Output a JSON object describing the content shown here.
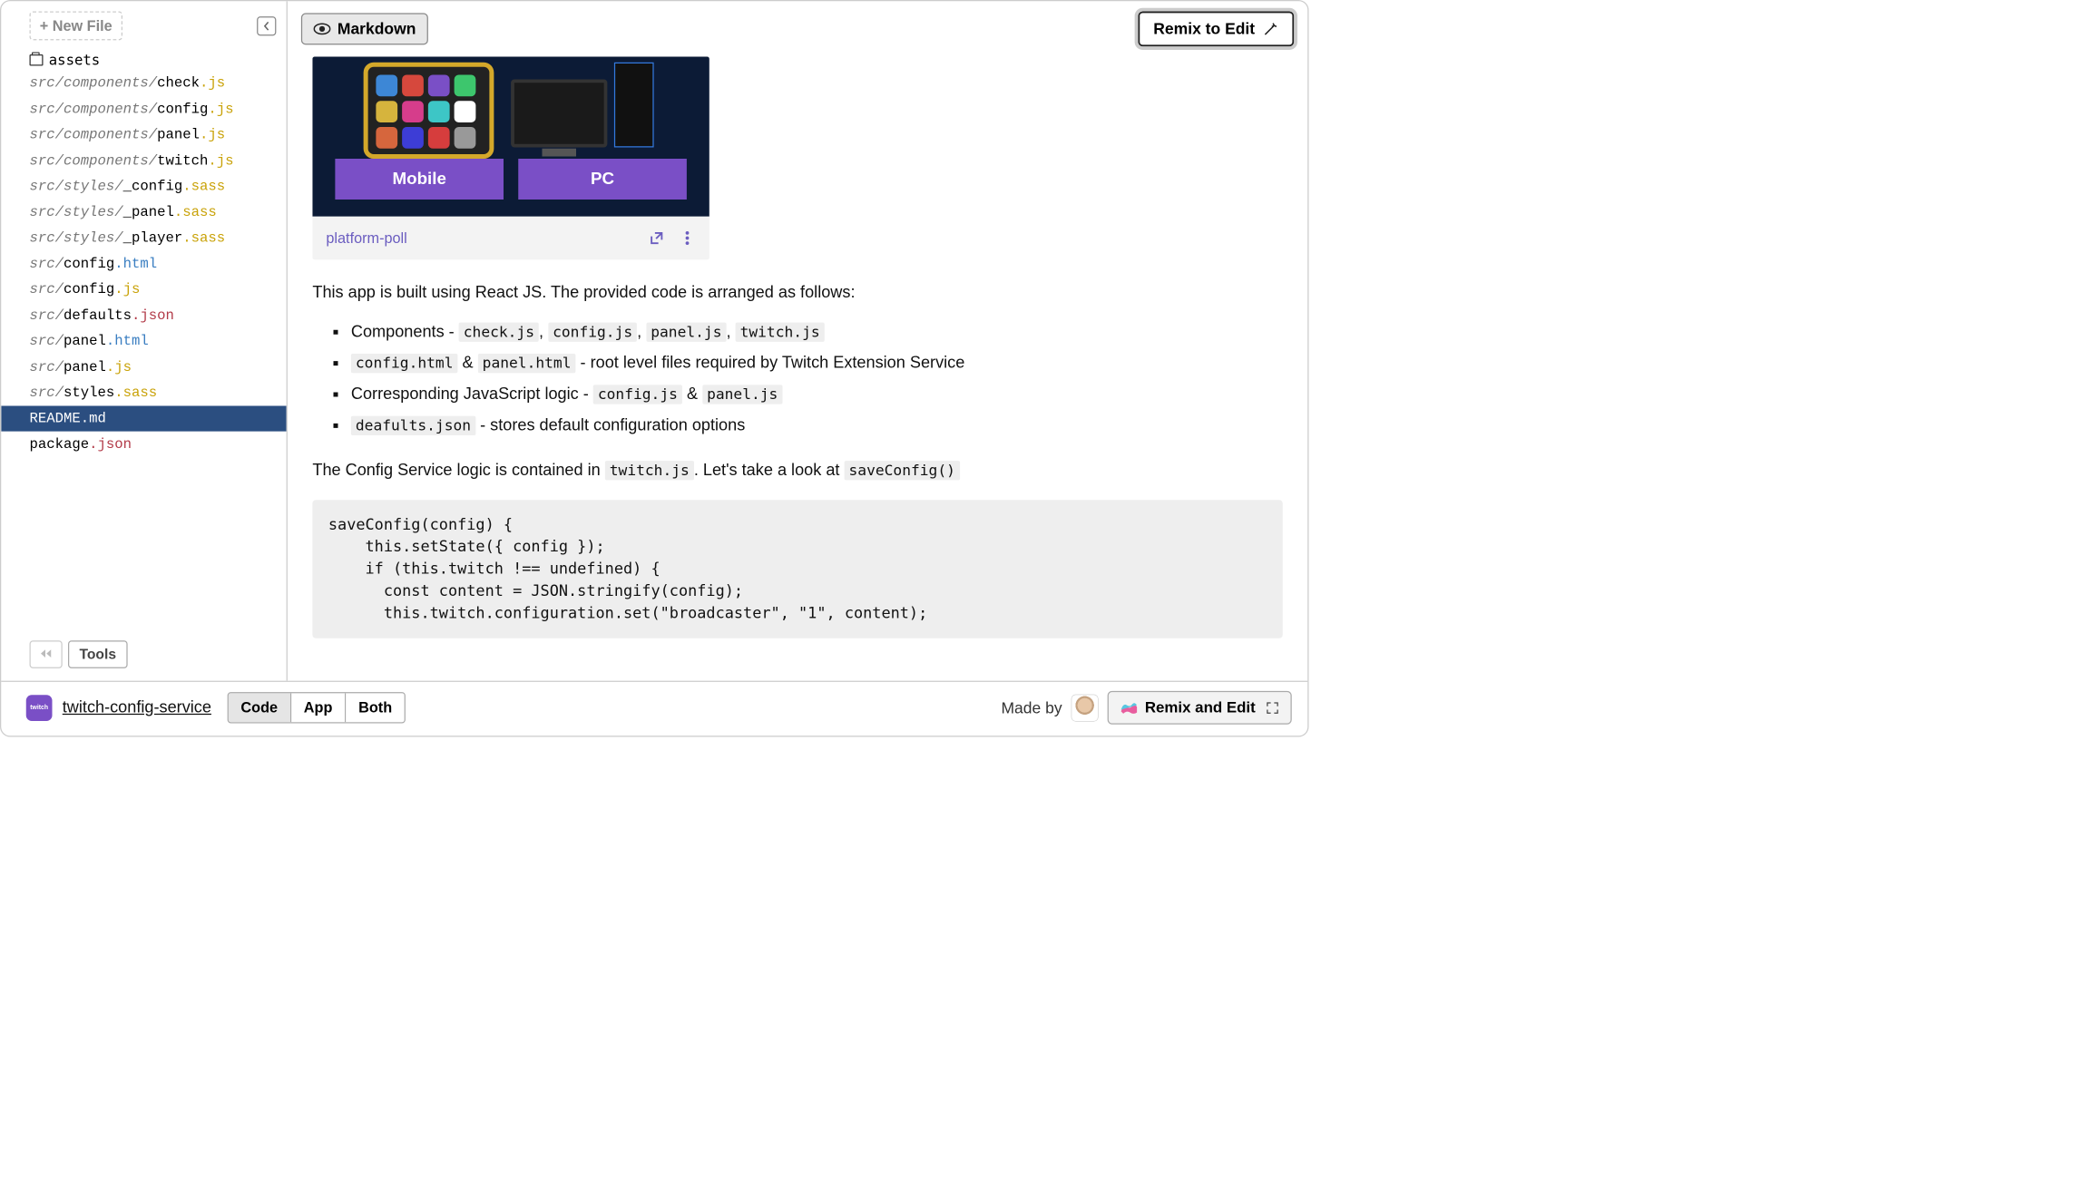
{
  "sidebar": {
    "new_file_label": "+ New File",
    "folder_name": "assets",
    "files": [
      {
        "path": "src/components/",
        "name": "check",
        "ext": ".js",
        "extClass": "ext-js"
      },
      {
        "path": "src/components/",
        "name": "config",
        "ext": ".js",
        "extClass": "ext-js"
      },
      {
        "path": "src/components/",
        "name": "panel",
        "ext": ".js",
        "extClass": "ext-js"
      },
      {
        "path": "src/components/",
        "name": "twitch",
        "ext": ".js",
        "extClass": "ext-js"
      },
      {
        "path": "src/styles/",
        "name": "_config",
        "ext": ".sass",
        "extClass": "ext-sass"
      },
      {
        "path": "src/styles/",
        "name": "_panel",
        "ext": ".sass",
        "extClass": "ext-sass"
      },
      {
        "path": "src/styles/",
        "name": "_player",
        "ext": ".sass",
        "extClass": "ext-sass"
      },
      {
        "path": "src/",
        "name": "config",
        "ext": ".html",
        "extClass": "ext-html"
      },
      {
        "path": "src/",
        "name": "config",
        "ext": ".js",
        "extClass": "ext-js"
      },
      {
        "path": "src/",
        "name": "defaults",
        "ext": ".json",
        "extClass": "ext-json"
      },
      {
        "path": "src/",
        "name": "panel",
        "ext": ".html",
        "extClass": "ext-html"
      },
      {
        "path": "src/",
        "name": "panel",
        "ext": ".js",
        "extClass": "ext-js"
      },
      {
        "path": "src/",
        "name": "styles",
        "ext": ".sass",
        "extClass": "ext-sass"
      },
      {
        "path": "",
        "name": "README",
        "ext": ".md",
        "extClass": "ext-md",
        "selected": true
      },
      {
        "path": "",
        "name": "package",
        "ext": ".json",
        "extClass": "ext-json"
      }
    ],
    "tools_label": "Tools"
  },
  "header": {
    "markdown_label": "Markdown",
    "remix_label": "Remix to Edit"
  },
  "markdown": {
    "preview_label": "platform-poll",
    "tile_mobile": "Mobile",
    "tile_pc": "PC",
    "p1": "This app is built using React JS. The provided code is arranged as follows:",
    "bullets": {
      "b1_prefix": "Components - ",
      "b1_c1": "check.js",
      "b1_c2": "config.js",
      "b1_c3": "panel.js",
      "b1_c4": "twitch.js",
      "b2_c1": "config.html",
      "b2_amp": " & ",
      "b2_c2": "panel.html",
      "b2_suffix": " - root level files required by Twitch Extension Service",
      "b3_prefix": "Corresponding JavaScript logic - ",
      "b3_c1": "config.js",
      "b3_amp": " & ",
      "b3_c2": "panel.js",
      "b4_c1": "deafults.json",
      "b4_suffix": " - stores default configuration options"
    },
    "p2_prefix": "The Config Service logic is contained in ",
    "p2_code": "twitch.js",
    "p2_mid": ". Let's take a look at ",
    "p2_code2": "saveConfig()",
    "codeblock": "saveConfig(config) {\n    this.setState({ config });\n    if (this.twitch !== undefined) {\n      const content = JSON.stringify(config);\n      this.twitch.configuration.set(\"broadcaster\", \"1\", content);"
  },
  "footer": {
    "project_name": "twitch-config-service",
    "badge_text": "twitch",
    "views": {
      "code": "Code",
      "app": "App",
      "both": "Both"
    },
    "made_by": "Made by",
    "remix_edit": "Remix and Edit"
  }
}
